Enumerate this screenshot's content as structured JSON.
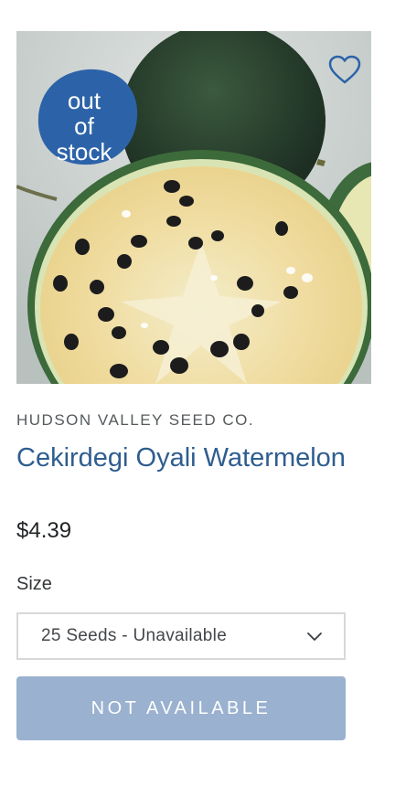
{
  "product": {
    "badge_text": "out\nof\nstock",
    "vendor": "HUDSON VALLEY SEED CO.",
    "title": "Cekirdegi Oyali Watermelon",
    "price": "$4.39",
    "size_label": "Size",
    "size_selected": "25 Seeds - Unavailable",
    "button_label": "NOT AVAILABLE"
  },
  "icons": {
    "wishlist": "heart-outline-icon",
    "dropdown": "chevron-down-icon"
  },
  "colors": {
    "accent_blue": "#2f5d8f",
    "badge_blue": "#2c63a8",
    "button_disabled": "#9ab1cf"
  }
}
